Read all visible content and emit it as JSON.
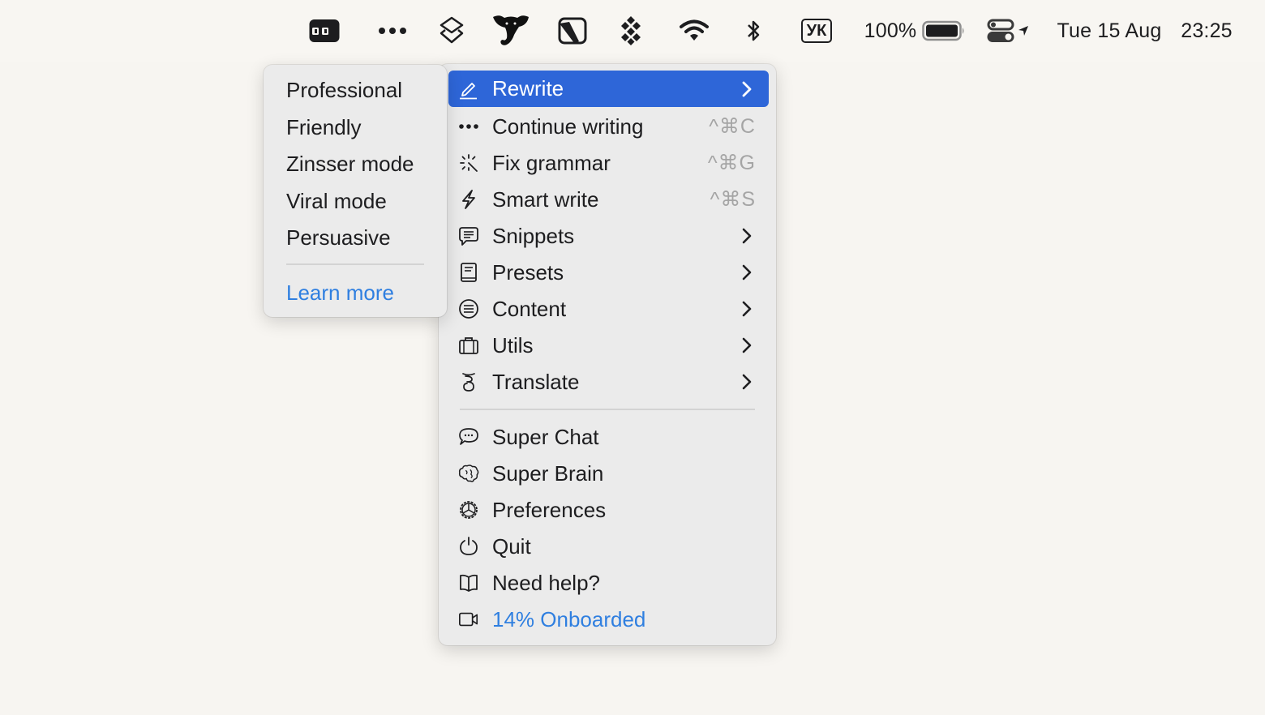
{
  "menubar": {
    "icons": [
      {
        "name": "app-window-icon"
      },
      {
        "name": "more-dots-icon"
      },
      {
        "name": "layers-icon"
      },
      {
        "name": "elephant-app-icon"
      },
      {
        "name": "pointer-app-icon"
      },
      {
        "name": "dropbox-like-icon"
      },
      {
        "name": "wifi-icon"
      },
      {
        "name": "bluetooth-icon"
      }
    ],
    "input_source": "УК",
    "battery_percent": "100%",
    "battery_level": 1.0,
    "date": "Tue 15 Aug",
    "time": "23:25"
  },
  "submenu": {
    "items": [
      "Professional",
      "Friendly",
      "Zinsser mode",
      "Viral mode",
      "Persuasive"
    ],
    "learn_more": "Learn more"
  },
  "main_menu": {
    "items": [
      {
        "label": "Rewrite",
        "icon": "pencil-icon",
        "submenu": true,
        "active": true
      },
      {
        "label": "Continue writing",
        "icon": "ellipsis-icon",
        "shortcut": "^⌘C"
      },
      {
        "label": "Fix grammar",
        "icon": "magic-wand-icon",
        "shortcut": "^⌘G"
      },
      {
        "label": "Smart write",
        "icon": "lightning-icon",
        "shortcut": "^⌘S"
      },
      {
        "label": "Snippets",
        "icon": "message-lines-icon",
        "submenu": true
      },
      {
        "label": "Presets",
        "icon": "book-icon",
        "submenu": true
      },
      {
        "label": "Content",
        "icon": "list-circle-icon",
        "submenu": true
      },
      {
        "label": "Utils",
        "icon": "briefcase-icon",
        "submenu": true
      },
      {
        "label": "Translate",
        "icon": "translate-glyph-icon",
        "submenu": true
      }
    ],
    "footer_items": [
      {
        "label": "Super Chat",
        "icon": "chat-bubble-icon"
      },
      {
        "label": "Super Brain",
        "icon": "brain-icon"
      },
      {
        "label": "Preferences",
        "icon": "gear-icon"
      },
      {
        "label": "Quit",
        "icon": "power-icon"
      },
      {
        "label": "Need help?",
        "icon": "open-book-icon"
      },
      {
        "label": "14% Onboarded",
        "icon": "video-camera-icon",
        "link": true
      }
    ]
  },
  "colors": {
    "accent": "#2e66d8",
    "link": "#2f7fe0",
    "shortcut": "#a5a5a5",
    "menu_bg": "#ebebeb",
    "desktop_bg": "#f7f5f1"
  }
}
